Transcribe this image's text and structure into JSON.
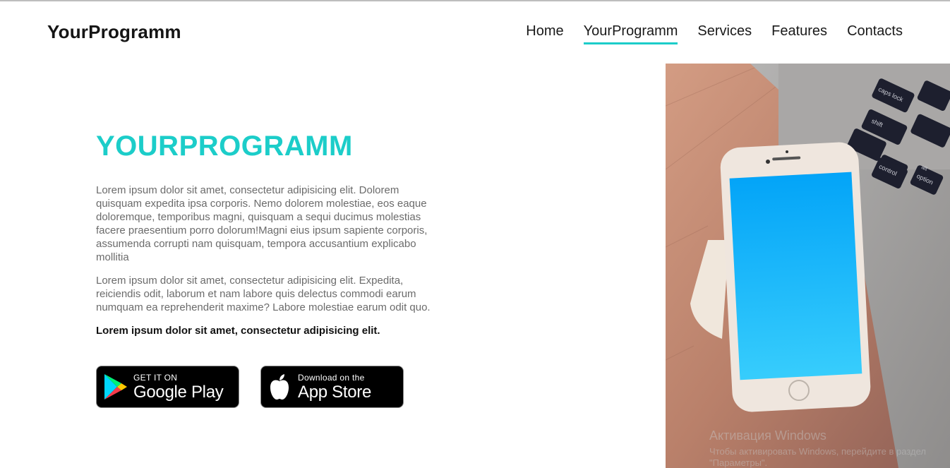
{
  "header": {
    "brand": "YourProgramm",
    "nav": [
      {
        "label": "Home"
      },
      {
        "label": "YourProgramm",
        "active": true
      },
      {
        "label": "Services"
      },
      {
        "label": "Features"
      },
      {
        "label": "Contacts"
      }
    ]
  },
  "hero": {
    "title": "YOURPROGRAMM",
    "paragraph1": "Lorem ipsum dolor sit amet, consectetur adipisicing elit. Dolorem quisquam expedita ipsa corporis. Nemo dolorem molestiae, eos eaque doloremque, temporibus magni, quisquam a sequi ducimus molestias facere praesentium porro dolorum!Magni eius ipsum sapiente corporis, assumenda corrupti nam quisquam, tempora accusantium explicabo mollitia",
    "paragraph2": "Lorem ipsum dolor sit amet, consectetur adipisicing elit. Expedita, reiciendis odit, laborum et nam labore quis delectus commodi earum numquam ea reprehenderit maxime? Labore molestiae earum odit quo.",
    "paragraph3": "Lorem ipsum dolor sit amet, consectetur adipisicing elit.",
    "google_play": {
      "small": "GET IT ON",
      "big": "Google Play",
      "icon": "google-play-icon"
    },
    "app_store": {
      "small": "Download on the",
      "big": "App Store",
      "icon": "apple-icon"
    }
  },
  "image": {
    "keyboard_keys": [
      "caps lock",
      "shift",
      "control",
      "option",
      "alt"
    ]
  },
  "os_overlay": {
    "title": "Активация Windows",
    "subtitle": "Чтобы активировать Windows, перейдите в раздел \"Параметры\"."
  },
  "colors": {
    "accent": "#1ccdc9",
    "phone_screen_top": "#03a4f8",
    "phone_screen_bottom": "#37cdfc"
  }
}
